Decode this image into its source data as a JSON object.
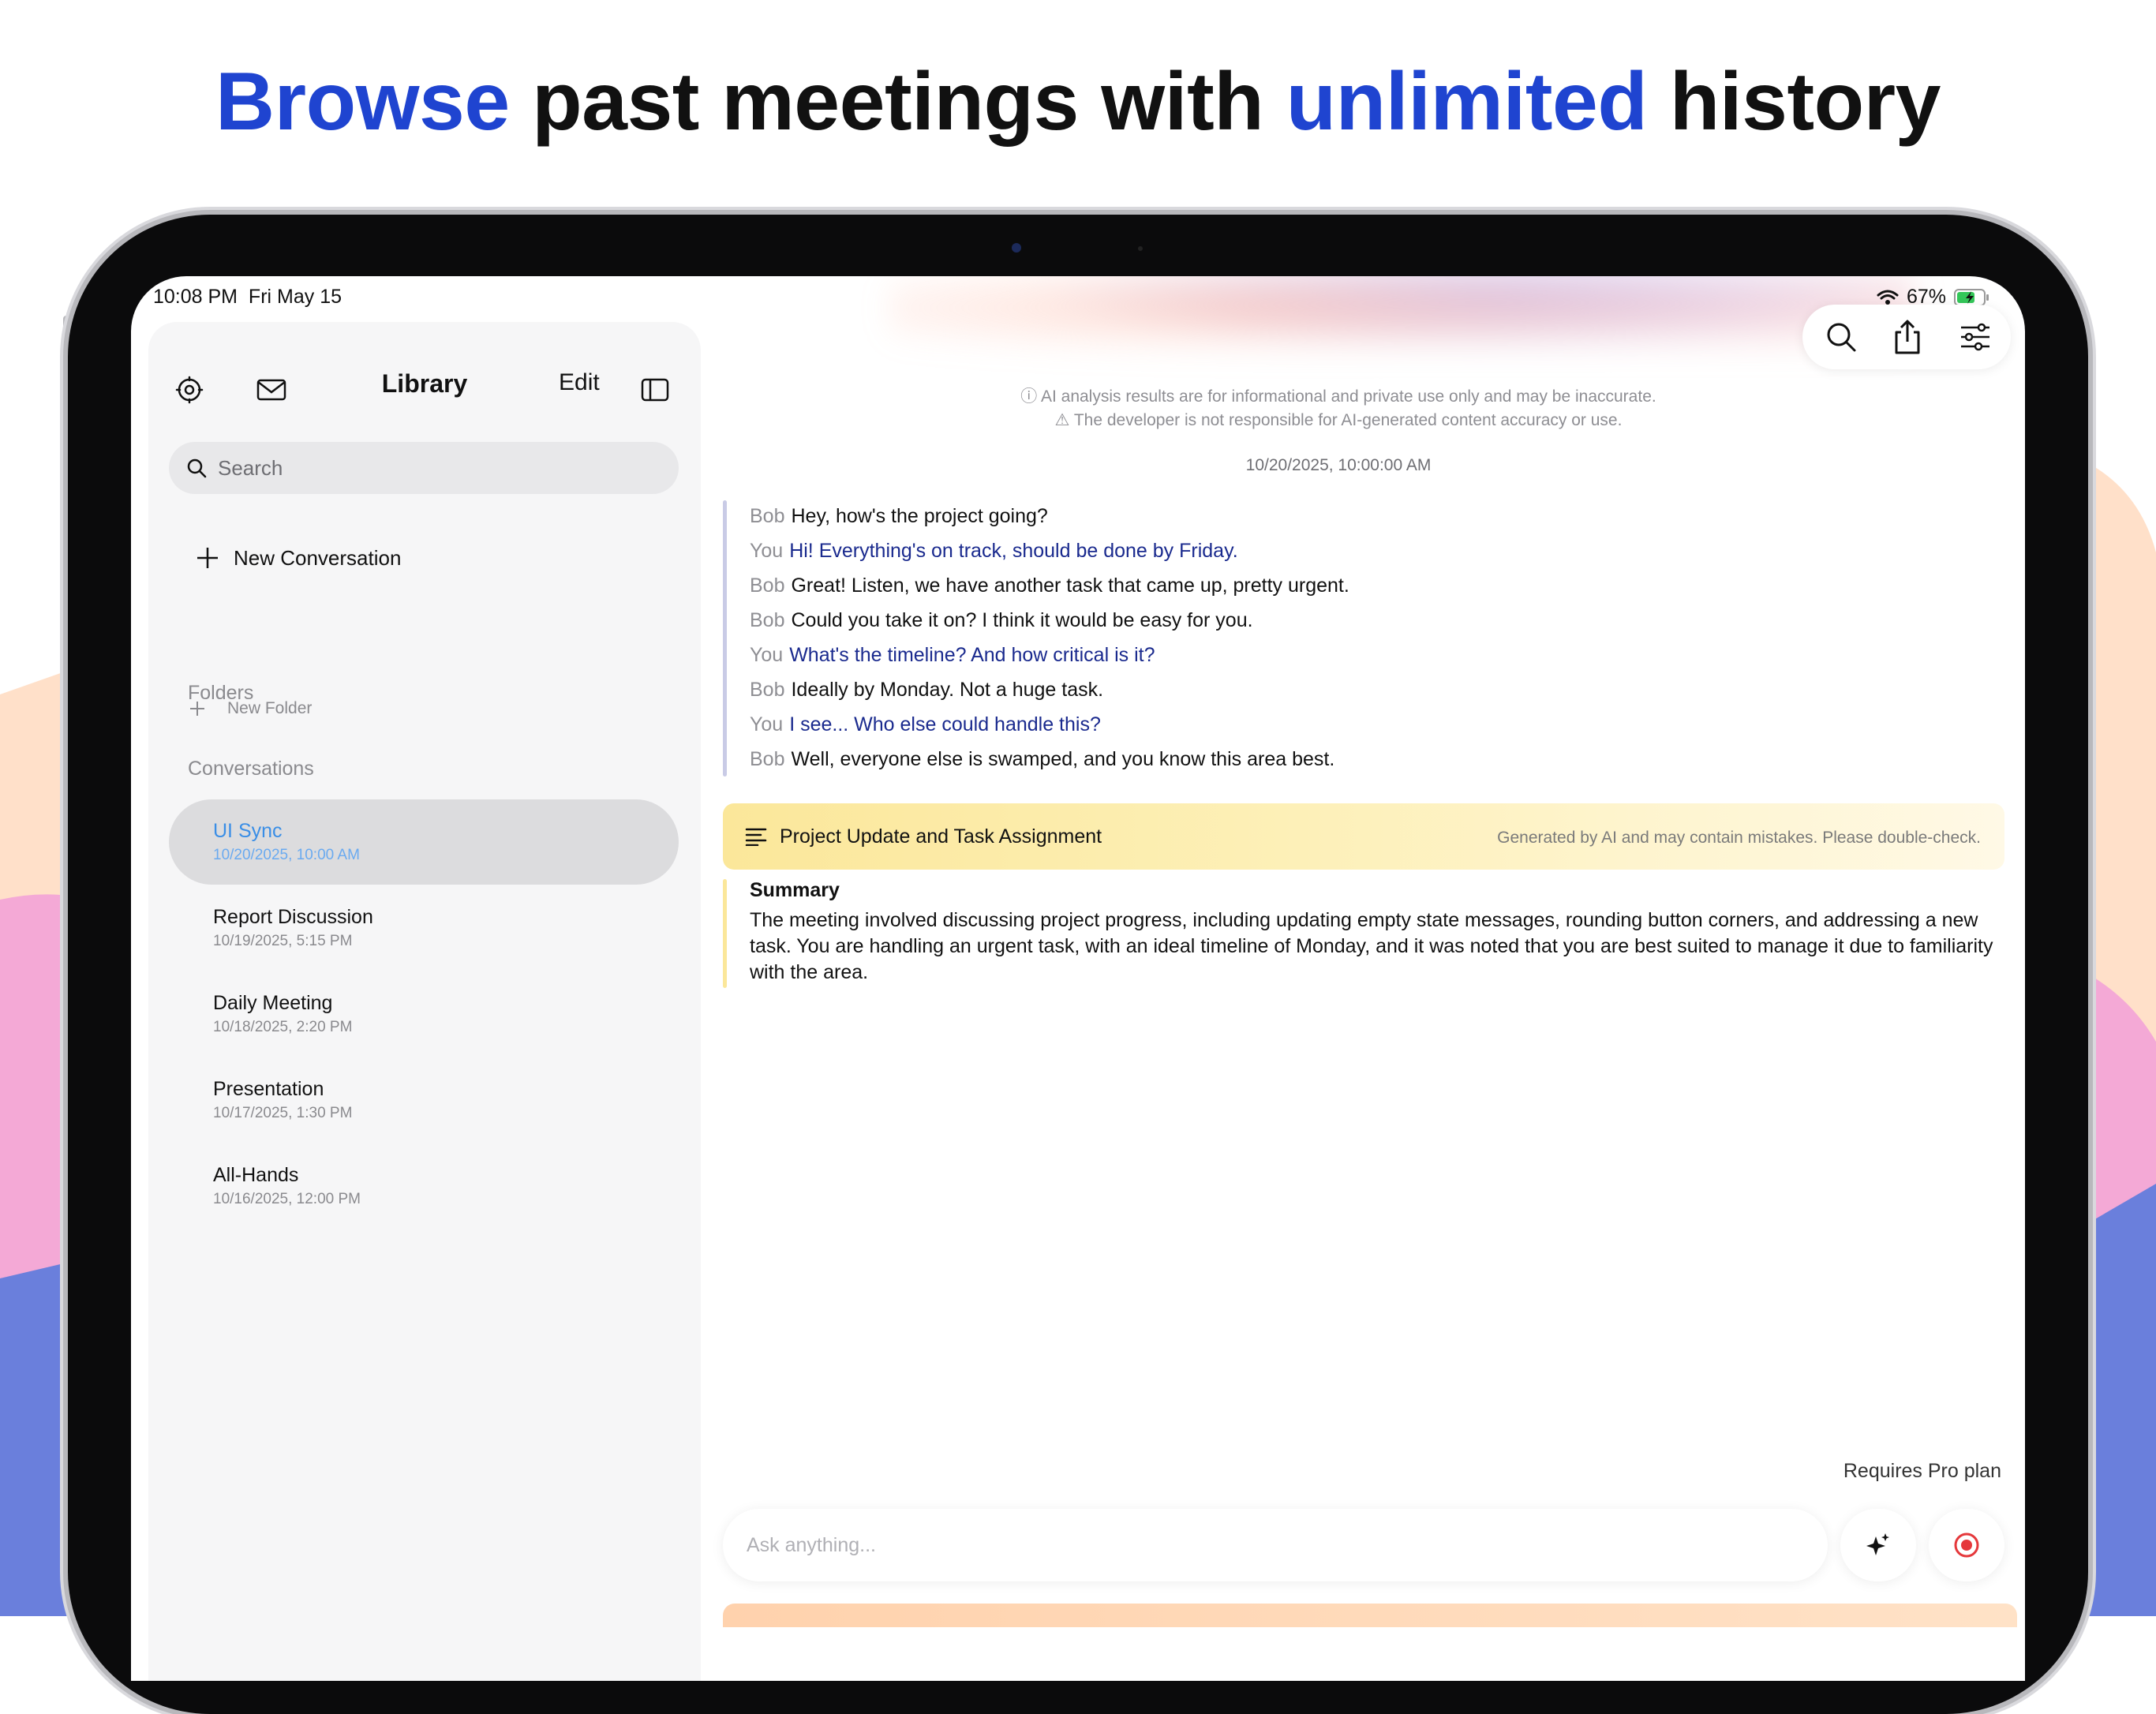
{
  "headline": {
    "part1": "Browse",
    "part2": " past meetings with ",
    "part3": "unlimited",
    "part4": " history",
    "accent_color": "#1f44d0"
  },
  "status_bar": {
    "time": "10:08 PM",
    "date": "Fri May 15",
    "battery": "67%"
  },
  "sidebar": {
    "title": "Library",
    "edit_label": "Edit",
    "search_placeholder": "Search",
    "new_conversation_label": "New Conversation",
    "folders_header": "Folders",
    "new_folder_label": "New Folder",
    "conversations_header": "Conversations",
    "conversations": [
      {
        "title": "UI Sync",
        "date": "10/20/2025, 10:00 AM",
        "active": true
      },
      {
        "title": "Report Discussion",
        "date": "10/19/2025, 5:15 PM"
      },
      {
        "title": "Daily Meeting",
        "date": "10/18/2025, 2:20 PM"
      },
      {
        "title": "Presentation",
        "date": "10/17/2025, 1:30 PM"
      },
      {
        "title": "All-Hands",
        "date": "10/16/2025, 12:00 PM"
      }
    ]
  },
  "main": {
    "disclaimer_1": "AI analysis results are for informational and private use only and may be inaccurate.",
    "disclaimer_2": "The developer is not responsible for AI-generated content accuracy or use.",
    "timestamp": "10/20/2025, 10:00:00 AM",
    "transcript": [
      {
        "speaker": "Bob",
        "text": "Hey, how's the project going?"
      },
      {
        "speaker": "You",
        "text": "Hi! Everything's on track, should be done by Friday."
      },
      {
        "speaker": "Bob",
        "text": "Great! Listen, we have another task that came up, pretty urgent."
      },
      {
        "speaker": "Bob",
        "text": "Could you take it on? I think it would be easy for you."
      },
      {
        "speaker": "You",
        "text": "What's the timeline? And how critical is it?"
      },
      {
        "speaker": "Bob",
        "text": "Ideally by Monday. Not a huge task."
      },
      {
        "speaker": "You",
        "text": "I see... Who else could handle this?"
      },
      {
        "speaker": "Bob",
        "text": "Well, everyone else is swamped, and you know this area best."
      }
    ],
    "summary_title": "Project Update and Task Assignment",
    "summary_note": "Generated by AI and may contain mistakes. Please double-check.",
    "summary_heading": "Summary",
    "summary_text": "The meeting involved discussing project progress, including updating empty state messages, rounding button corners, and addressing a new task. You are handling an urgent task, with an ideal timeline of Monday, and it was noted that you are best suited to manage it due to familiarity with the area.",
    "pro_note": "Requires Pro plan",
    "ask_placeholder": "Ask anything..."
  },
  "icons": {
    "settings": "gear-icon",
    "mail": "envelope-icon",
    "sidebar_toggle": "sidebar-icon",
    "search": "search-icon",
    "share": "share-icon",
    "filters": "sliders-icon",
    "sparkle": "sparkle-icon",
    "record": "record-icon"
  },
  "colors": {
    "active_item": "#3a8ee6",
    "you_text": "#1a2a8e",
    "record_red": "#e5383b"
  }
}
